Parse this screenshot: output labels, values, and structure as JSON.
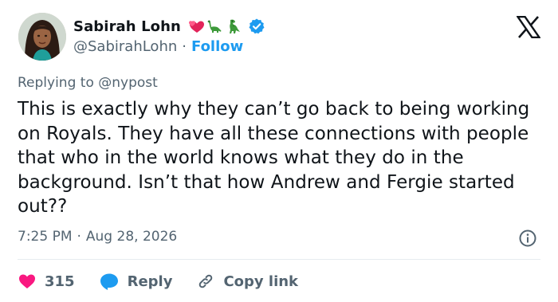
{
  "author": {
    "display_name": "Sabirah Lohn",
    "emojis": [
      "two-hearts-emoji",
      "sauropod-emoji",
      "t-rex-emoji"
    ],
    "handle": "@SabirahLohn",
    "separator": "·",
    "follow_label": "Follow"
  },
  "reply_context": {
    "prefix": "Replying to",
    "mention": "@nypost"
  },
  "tweet": {
    "text": "This is exactly why they can’t go back to being working on Royals. They have all these connections with people that who in the world knows what they do in the background. Isn’t that how Andrew and Fergie started out??",
    "time": "7:25 PM",
    "date_separator": "·",
    "date": "Aug 28, 2026"
  },
  "actions": {
    "like_count": "315",
    "reply_label": "Reply",
    "copy_label": "Copy link"
  },
  "colors": {
    "like_red": "#f91880",
    "reply_blue": "#1d9bf0",
    "verified_blue": "#1d9bf0",
    "muted_gray": "#536471"
  }
}
